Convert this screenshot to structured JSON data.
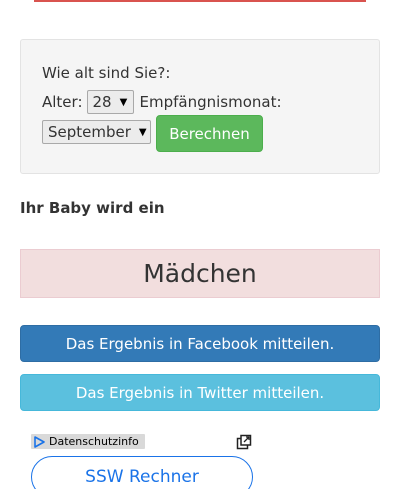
{
  "colors": {
    "accent_red": "#d9534f",
    "success_green": "#5cb85c",
    "facebook_blue": "#337ab7",
    "twitter_blue": "#5bc0de",
    "result_pink": "#f2dede",
    "ad_blue": "#1a73e8"
  },
  "form": {
    "question": "Wie alt sind Sie?:",
    "age_label": "Alter:",
    "age_value": "28",
    "month_label": "Empfängnismonat:",
    "month_value": "September",
    "submit_label": "Berechnen"
  },
  "result": {
    "label": "Ihr Baby wird ein",
    "value": "Mädchen"
  },
  "share": {
    "facebook_label": "Das Ergebnis in Facebook mitteilen.",
    "twitter_label": "Das Ergebnis in Twitter mitteilen."
  },
  "ad": {
    "privacy_label": "Datenschutzinfo",
    "privacy_icon": "adchoices-play-icon",
    "expand_icon": "open-in-new-icon",
    "cta_label": "SSW Rechner"
  }
}
